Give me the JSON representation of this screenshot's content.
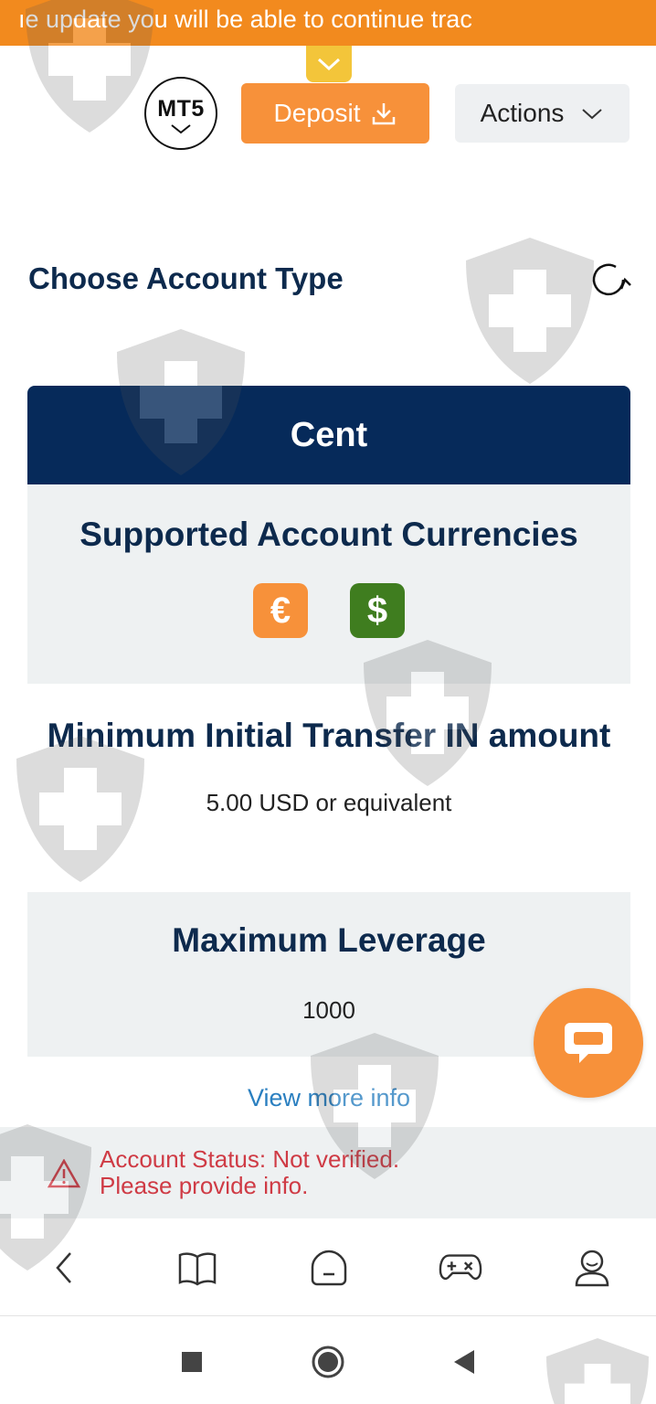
{
  "ticker": {
    "text": "ıe update you will be able to continue trac"
  },
  "toolbar": {
    "platform_label": "MT5",
    "deposit_label": "Deposit",
    "actions_label": "Actions"
  },
  "page": {
    "title": "Choose Account Type"
  },
  "account_card": {
    "type_name": "Cent",
    "currencies_title": "Supported Account Currencies",
    "currencies": [
      {
        "symbol": "€",
        "icon": "euro-icon",
        "color": "#f7913a"
      },
      {
        "symbol": "$",
        "icon": "dollar-icon",
        "color": "#3f7d1f"
      }
    ],
    "min_transfer_title": "Minimum Initial Transfer IN amount",
    "min_transfer_value": "5.00 USD or equivalent",
    "max_leverage_title": "Maximum Leverage",
    "max_leverage_value": "1000",
    "more_info_link": "View more info"
  },
  "status": {
    "line1": "Account Status: Not verified.",
    "line2": "Please provide info."
  },
  "bottom_nav": [
    "back-icon",
    "book-icon",
    "home-icon",
    "gamepad-icon",
    "profile-icon"
  ],
  "colors": {
    "brand_orange": "#f7913a",
    "ticker_orange": "#f28a1e",
    "navy": "#062a5a",
    "title_navy": "#0d2a4d",
    "status_red": "#cf3b45",
    "link_blue": "#2a7fc0",
    "usd_green": "#3f7d1f"
  }
}
